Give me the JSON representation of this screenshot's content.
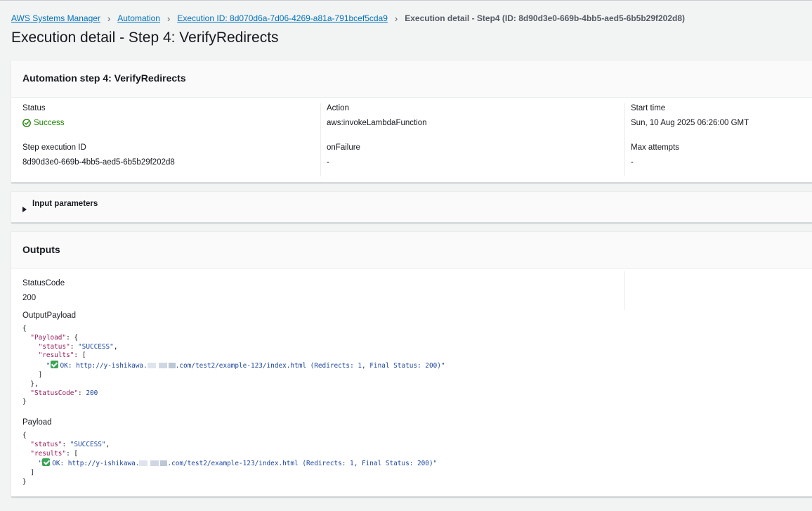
{
  "breadcrumb": {
    "items": [
      "AWS Systems Manager",
      "Automation",
      "Execution ID: 8d070d6a-7d06-4269-a81a-791bcef5cda9"
    ],
    "current": "Execution detail - Step4 (ID: 8d90d3e0-669b-4bb5-aed5-6b5b29f202d8)"
  },
  "page": {
    "title": "Execution detail - Step 4: VerifyRedirects"
  },
  "step": {
    "header": "Automation step 4: VerifyRedirects",
    "status_label": "Status",
    "status_value": "Success",
    "step_execution_id_label": "Step execution ID",
    "step_execution_id_value": "8d90d3e0-669b-4bb5-aed5-6b5b29f202d8",
    "action_label": "Action",
    "action_value": "aws:invokeLambdaFunction",
    "onfailure_label": "onFailure",
    "onfailure_value": "-",
    "start_time_label": "Start time",
    "start_time_value": "Sun, 10 Aug 2025 06:26:00 GMT",
    "max_attempts_label": "Max attempts",
    "max_attempts_value": "-"
  },
  "input_parameters": {
    "label": "Input parameters"
  },
  "outputs": {
    "header": "Outputs",
    "status_code_label": "StatusCode",
    "status_code_value": "200",
    "output_payload_label": "OutputPayload",
    "payload_label": "Payload",
    "json": {
      "brace_open": "{",
      "brace_close": "}",
      "bracket_open": "[",
      "bracket_close": "]",
      "payload_key": "\"Payload\"",
      "status_key": "\"status\"",
      "status_value": "\"SUCCESS\"",
      "results_key": "\"results\"",
      "statuscode_key": "\"StatusCode\"",
      "statuscode_value": "200",
      "result_quote": "\"",
      "result_prefix": "OK: http://y-ishikawa.",
      "result_suffix": ".com/test2/example-123/index.html (Redirects: 1, Final Status: 200)\""
    }
  }
}
